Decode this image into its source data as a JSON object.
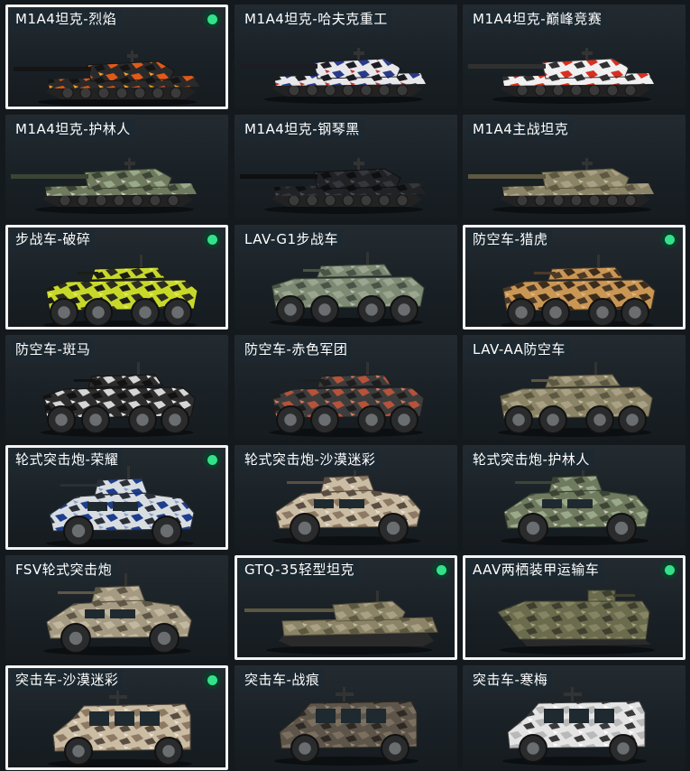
{
  "colors": {
    "accent": "#34e08a",
    "selected_border": "#f2f2f2",
    "background": "#14191d"
  },
  "cards": [
    {
      "label": "M1A4坦克-烈焰",
      "selected": true,
      "owned": true,
      "vehicle": "tank",
      "skin": "flame"
    },
    {
      "label": "M1A4坦克-哈夫克重工",
      "selected": false,
      "owned": false,
      "vehicle": "tank",
      "skin": "haavk"
    },
    {
      "label": "M1A4坦克-巅峰竞赛",
      "selected": false,
      "owned": false,
      "vehicle": "tank",
      "skin": "race"
    },
    {
      "label": "M1A4坦克-护林人",
      "selected": false,
      "owned": false,
      "vehicle": "tank",
      "skin": "forest"
    },
    {
      "label": "M1A4坦克-钢琴黑",
      "selected": false,
      "owned": false,
      "vehicle": "tank",
      "skin": "black"
    },
    {
      "label": "M1A4主战坦克",
      "selected": false,
      "owned": false,
      "vehicle": "tank",
      "skin": "khaki"
    },
    {
      "label": "步战车-破碎",
      "selected": true,
      "owned": true,
      "vehicle": "ifv",
      "skin": "shatter"
    },
    {
      "label": "LAV-G1步战车",
      "selected": false,
      "owned": false,
      "vehicle": "ifv",
      "skin": "green"
    },
    {
      "label": "防空车-猎虎",
      "selected": true,
      "owned": true,
      "vehicle": "ifv",
      "skin": "tiger"
    },
    {
      "label": "防空车-斑马",
      "selected": false,
      "owned": false,
      "vehicle": "ifv",
      "skin": "zebra"
    },
    {
      "label": "防空车-赤色军团",
      "selected": false,
      "owned": false,
      "vehicle": "ifv",
      "skin": "redcamo"
    },
    {
      "label": "LAV-AA防空车",
      "selected": false,
      "owned": false,
      "vehicle": "ifv",
      "skin": "khaki"
    },
    {
      "label": "轮式突击炮-荣耀",
      "selected": true,
      "owned": true,
      "vehicle": "assault",
      "skin": "glory"
    },
    {
      "label": "轮式突击炮-沙漠迷彩",
      "selected": false,
      "owned": false,
      "vehicle": "assault",
      "skin": "desert"
    },
    {
      "label": "轮式突击炮-护林人",
      "selected": false,
      "owned": false,
      "vehicle": "assault",
      "skin": "forest"
    },
    {
      "label": "FSV轮式突击炮",
      "selected": false,
      "owned": false,
      "vehicle": "assault",
      "skin": "tan"
    },
    {
      "label": "GTQ-35轻型坦克",
      "selected": true,
      "owned": true,
      "vehicle": "light_tank",
      "skin": "khaki"
    },
    {
      "label": "AAV两栖装甲运输车",
      "selected": true,
      "owned": true,
      "vehicle": "aav",
      "skin": "olive"
    },
    {
      "label": "突击车-沙漠迷彩",
      "selected": true,
      "owned": true,
      "vehicle": "truck",
      "skin": "desert"
    },
    {
      "label": "突击车-战痕",
      "selected": false,
      "owned": false,
      "vehicle": "truck",
      "skin": "brown"
    },
    {
      "label": "突击车-寒梅",
      "selected": false,
      "owned": false,
      "vehicle": "truck",
      "skin": "white"
    }
  ]
}
